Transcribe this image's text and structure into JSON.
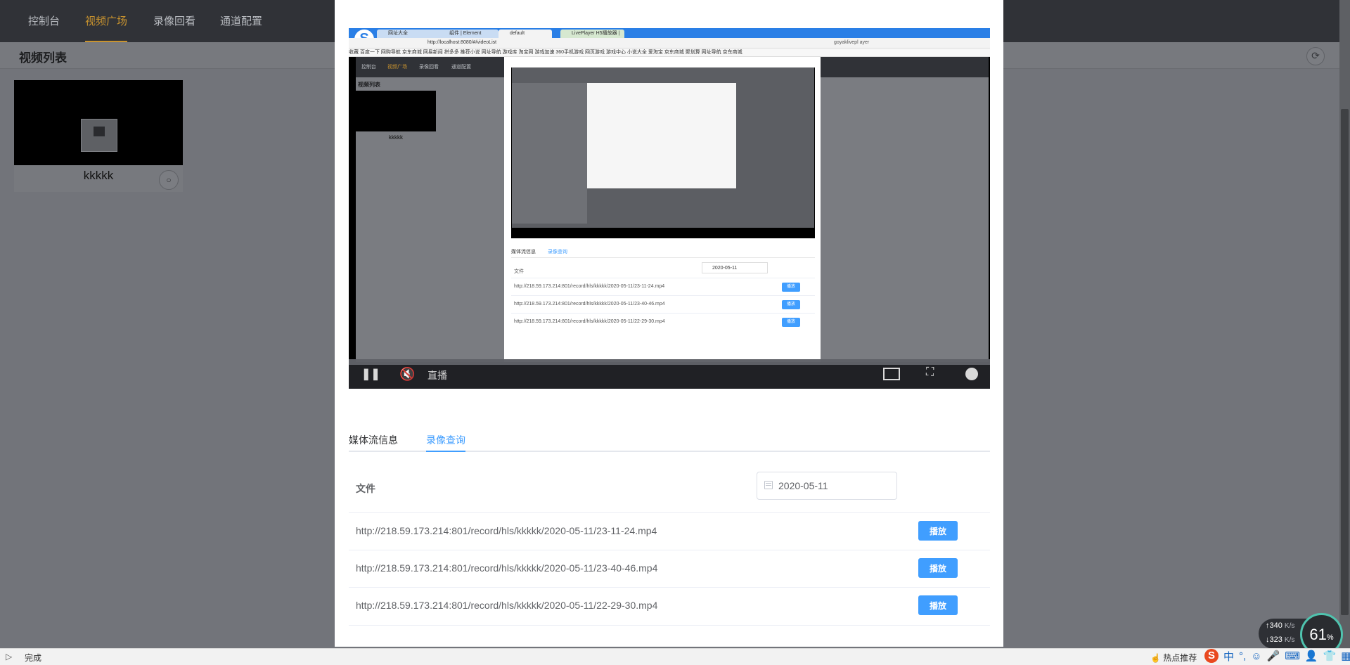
{
  "nav": {
    "items": [
      "控制台",
      "视频广场",
      "录像回看",
      "通道配置"
    ],
    "active": 1
  },
  "page": {
    "title": "视频列表",
    "refresh_icon": "refresh-icon"
  },
  "card": {
    "name": "kkkkk",
    "search_icon": "search-icon"
  },
  "player": {
    "live_label": "直播",
    "browser": {
      "tabs": [
        "网址大全",
        "组件 | Element",
        "default",
        "LivePlayer H5播放器 |"
      ],
      "url": "http://localhost:8080/#/videoList",
      "search": "goyaklivepl ayer",
      "bookmarks": "收藏  百度一下  网购导航  京东商城  网易新闻  拼多多  推荐小说  网址导航  游戏库  淘宝网  游戏加速  360手机游戏  网页游戏  游戏中心  小说大全  爱淘宝  京东商城  聚划算  网址导航  京东商城"
    },
    "inner": {
      "nav": [
        "控制台",
        "视频广场",
        "录像回看",
        "通道配置"
      ],
      "title": "视频列表",
      "card_name": "kkkkk",
      "tabs": [
        "媒体流信息",
        "录像查询"
      ],
      "file_label": "文件",
      "date": "2020-05-11",
      "rows": [
        "http://218.59.173.214:801/record/hls/kkkkk/2020-05-11/23-11-24.mp4",
        "http://218.59.173.214:801/record/hls/kkkkk/2020-05-11/23-40-46.mp4",
        "http://218.59.173.214:801/record/hls/kkkkk/2020-05-11/22-29-30.mp4"
      ],
      "play_label": "播放"
    }
  },
  "dialog": {
    "tabs": [
      "媒体流信息",
      "录像查询"
    ],
    "active_tab": 1,
    "file_label": "文件",
    "date": "2020-05-11",
    "rows": [
      {
        "url": "http://218.59.173.214:801/record/hls/kkkkk/2020-05-11/23-11-24.mp4",
        "action": "播放"
      },
      {
        "url": "http://218.59.173.214:801/record/hls/kkkkk/2020-05-11/23-40-46.mp4",
        "action": "播放"
      },
      {
        "url": "http://218.59.173.214:801/record/hls/kkkkk/2020-05-11/22-29-30.mp4",
        "action": "播放"
      }
    ]
  },
  "status": {
    "text": "完成",
    "hot": "热点推荐"
  },
  "ime": {
    "logo": "S",
    "mode": "中",
    "punct": "°,"
  },
  "net": {
    "up": "340",
    "down": "323",
    "unit": "K/s",
    "percent": "61",
    "percent_sign": "%"
  },
  "colors": {
    "accent": "#409eff",
    "nav_active": "#c8932f",
    "topbar": "#303237"
  }
}
